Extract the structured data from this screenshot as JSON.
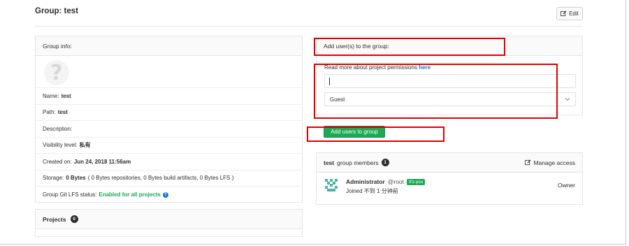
{
  "header": {
    "title": "Group: test",
    "edit_label": "Edit"
  },
  "info": {
    "heading": "Group info:",
    "rows": {
      "name_label": "Name:",
      "name_value": "test",
      "path_label": "Path:",
      "path_value": "test",
      "description_label": "Description:",
      "visibility_label": "Visibility level:",
      "visibility_value": "私有",
      "created_label": "Created on:",
      "created_value": "Jun 24, 2018 11:56am",
      "storage_label": "Storage:",
      "storage_value": "0 Bytes",
      "storage_detail": "( 0 Bytes repositories, 0 Bytes build artifacts, 0 Bytes LFS )",
      "lfs_label": "Group Git LFS status:",
      "lfs_value": "Enabled for all projects"
    }
  },
  "projects": {
    "heading": "Projects",
    "count": "0"
  },
  "add_users": {
    "heading": "Add user(s) to the group:",
    "perm_text": "Read more about project permissions",
    "perm_link": "here",
    "input_value": "",
    "role_selected": "Guest",
    "submit_label": "Add users to group"
  },
  "members": {
    "group_name": "test",
    "heading_suffix": "group members",
    "count": "1",
    "manage_label": "Manage access",
    "list": [
      {
        "name": "Administrator",
        "handle": "@root",
        "badge": "It's you",
        "joined": "Joined 不到 1 分钟前",
        "role": "Owner"
      }
    ]
  },
  "colors": {
    "accent_green": "#1aaa55",
    "link_blue": "#1f78d1",
    "annotation_red": "#e00000"
  }
}
